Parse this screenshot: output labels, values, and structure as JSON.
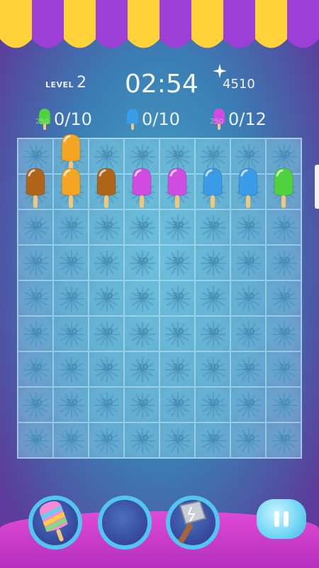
{
  "hud": {
    "level_label": "LEVEL",
    "level_value": "2",
    "timer": "02:54",
    "score": "4510"
  },
  "goals": [
    {
      "color": "green",
      "text": "0/10",
      "badge": "250"
    },
    {
      "color": "blue",
      "text": "0/10"
    },
    {
      "color": "purple",
      "text": "0/12",
      "badge": "250"
    }
  ],
  "board": {
    "cols": 8,
    "rows": 9,
    "cell_value": "30",
    "popsicles": [
      {
        "col": 1,
        "row": 0,
        "color": "orange"
      },
      {
        "col": 0,
        "row": 1,
        "color": "brown"
      },
      {
        "col": 1,
        "row": 1,
        "color": "orange"
      },
      {
        "col": 2,
        "row": 1,
        "color": "brown"
      },
      {
        "col": 3,
        "row": 1,
        "color": "purple"
      },
      {
        "col": 4,
        "row": 1,
        "color": "purple"
      },
      {
        "col": 5,
        "row": 1,
        "color": "blue"
      },
      {
        "col": 6,
        "row": 1,
        "color": "blue"
      },
      {
        "col": 7,
        "row": 1,
        "color": "green"
      }
    ]
  },
  "colors": {
    "orange": "#f3a523",
    "brown": "#b0641a",
    "purple": "#d24be0",
    "blue": "#3a9be6",
    "green": "#4fd23c",
    "stick": "#f2c77a"
  },
  "tools": [
    {
      "name": "rainbow-popsicle-booster",
      "icon": "rainbow-popsicle-icon"
    },
    {
      "name": "empty-booster-slot",
      "icon": ""
    },
    {
      "name": "hammer-booster",
      "icon": "hammer-icon"
    }
  ],
  "pause_icon": "pause-icon"
}
